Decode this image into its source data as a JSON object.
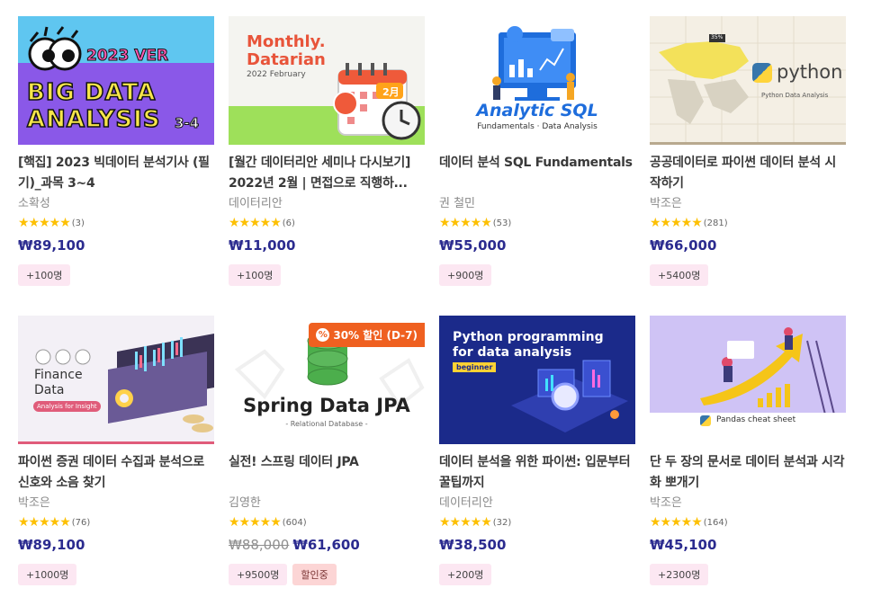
{
  "courses": [
    {
      "thumb": {
        "line1": "2023 VER",
        "line2": "BIG DATA",
        "line3": "ANALYSIS",
        "badge": "3-4"
      },
      "title": "[핵집] 2023 빅데이터 분석기사 (필기)_과목 3~4",
      "author": "소확성",
      "stars": "★★★★★",
      "count": "(3)",
      "price": "₩89,100",
      "tags": [
        "+100명"
      ]
    },
    {
      "thumb": {
        "line1": "Monthly.",
        "line2": "Datarian",
        "line3": "2022 February",
        "badge": "2月"
      },
      "title": "[월간 데이터리안 세미나 다시보기] 2022년 2월 | 면접으로 직행하...",
      "author": "데이터리안",
      "stars": "★★★★★",
      "count": "(6)",
      "price": "₩11,000",
      "tags": [
        "+100명"
      ]
    },
    {
      "thumb": {
        "line1": "Analytic SQL",
        "line2": "Fundamentals · Data Analysis"
      },
      "title": "데이터 분석 SQL Fundamentals",
      "author": "권 철민",
      "stars": "★★★★★",
      "count": "(53)",
      "price": "₩55,000",
      "tags": [
        "+900명"
      ]
    },
    {
      "thumb": {
        "line1": "python",
        "line2": "Python Data Analysis",
        "badge": "35%"
      },
      "title": "공공데이터로 파이썬 데이터 분석 시작하기",
      "author": "박조은",
      "stars": "★★★★★",
      "count": "(281)",
      "price": "₩66,000",
      "tags": [
        "+5400명"
      ]
    },
    {
      "thumb": {
        "line1": "Finance",
        "line2": "Data",
        "line3": "Analysis for Insight"
      },
      "title": "파이썬 증권 데이터 수집과 분석으로 신호와 소음 찾기",
      "author": "박조은",
      "stars": "★★★★★",
      "count": "(76)",
      "price": "₩89,100",
      "tags": [
        "+1000명"
      ]
    },
    {
      "thumb": {
        "line1": "Spring Data JPA",
        "line2": "- Relational Database -"
      },
      "sale": "30% 할인 (D-7)",
      "title": "실전! 스프링 데이터 JPA",
      "author": "김영한",
      "stars": "★★★★★",
      "count": "(604)",
      "old_price": "₩88,000",
      "price": "₩61,600",
      "tags": [
        "+9500명",
        "할인중"
      ]
    },
    {
      "thumb": {
        "line1": "Python programming",
        "line2": "for data analysis",
        "line3": "beginner"
      },
      "title": "데이터 분석을 위한 파이썬: 입문부터 꿀팁까지",
      "author": "데이터리안",
      "stars": "★★★★★",
      "count": "(32)",
      "price": "₩38,500",
      "tags": [
        "+200명"
      ]
    },
    {
      "thumb": {
        "line1": "Pandas cheat sheet"
      },
      "title": "단 두 장의 문서로 데이터 분석과 시각화 뽀개기",
      "author": "박조은",
      "stars": "★★★★★",
      "count": "(164)",
      "price": "₩45,100",
      "tags": [
        "+2300명"
      ]
    }
  ]
}
